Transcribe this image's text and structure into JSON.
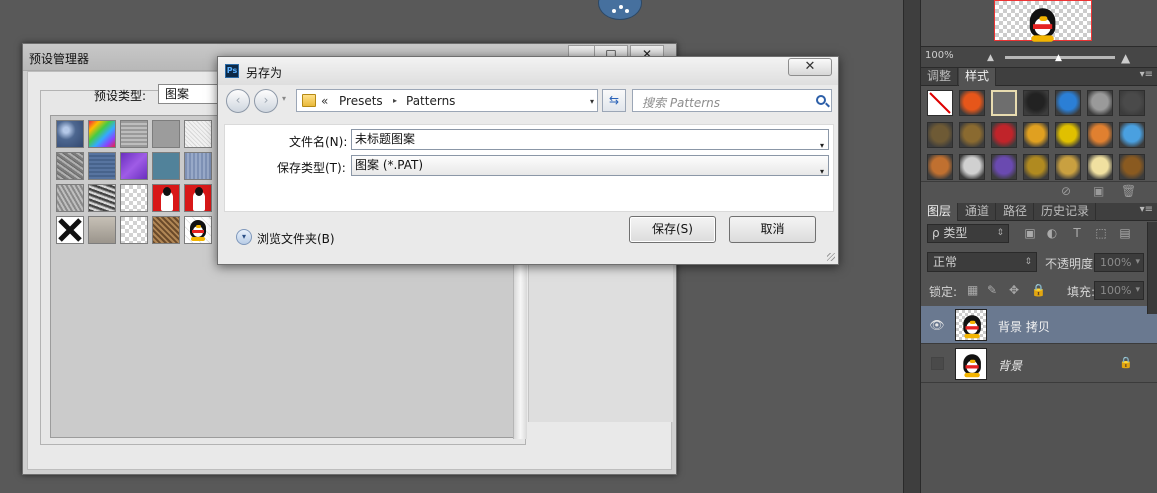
{
  "preset_manager": {
    "title": "预设管理器",
    "controls": {
      "minimize": "_",
      "maximize": "□",
      "close": "✕"
    },
    "preset_type_label": "预设类型:",
    "preset_type_value": "图案",
    "swatches": [
      "bubbles-pattern",
      "rainbow-pattern",
      "gray-granite-pattern",
      "gray-pattern",
      "light-gray-pattern",
      "stone-pattern",
      "blue-stone-pattern",
      "purple-pattern",
      "teal-pattern",
      "blue-gray-pattern",
      "gray-texture-pattern",
      "black-white-noise-pattern",
      "transparent-checker-pattern",
      "portrait-red-1-pattern",
      "portrait-red-2-pattern",
      "x-mark-pattern",
      "concrete-pattern",
      "wood-pattern",
      "white-dots-pattern",
      "penguin-pattern"
    ]
  },
  "save_dialog": {
    "title": "另存为",
    "ps_badge": "Ps",
    "close_glyph": "✕",
    "nav_back": "‹",
    "nav_forward": "›",
    "nav_dropdown": "▾",
    "address_prefix": "«",
    "breadcrumbs": [
      "Presets",
      "Patterns"
    ],
    "crumb_separator": "▸",
    "address_dropdown": "▾",
    "refresh_glyph": "⇆",
    "search_placeholder": "搜索 Patterns",
    "filename_label": "文件名(N):",
    "filename_value": "未标题图案",
    "filetype_label": "保存类型(T):",
    "filetype_value": "图案 (*.PAT)",
    "dropdown_glyph": "▾",
    "browse_glyph": "▾",
    "browse_label": "浏览文件夹(B)",
    "save_button": "保存(S)",
    "cancel_button": "取消"
  },
  "right_panels": {
    "zoom": "100%",
    "zoom_min_glyph": "▲",
    "zoom_handle_glyph": "▲",
    "zoom_max_glyph": "▲",
    "menu_glyph": "▾≡",
    "style_tabs": [
      "调整",
      "样式"
    ],
    "style_swatches": [
      {
        "name": "none-style",
        "color": "#ffffff"
      },
      {
        "name": "red-glow-style",
        "color": "#e6561a"
      },
      {
        "name": "beige-frame-style",
        "color": "#6e6e6e"
      },
      {
        "name": "black-chrome-style",
        "color": "#222222"
      },
      {
        "name": "blue-glass-style",
        "color": "#2b7fd6"
      },
      {
        "name": "gray-flat-style",
        "color": "#9a9a9a"
      },
      {
        "name": "dark-gray-style",
        "color": "#4a4a4a"
      },
      {
        "name": "bronze-style",
        "color": "#6e5a35"
      },
      {
        "name": "brown-bevel-style",
        "color": "#8a6a30"
      },
      {
        "name": "red-stripe-style",
        "color": "#c0242a"
      },
      {
        "name": "multicolor-style",
        "color": "#e0a020"
      },
      {
        "name": "yellow-frame-style",
        "color": "#e0c000"
      },
      {
        "name": "orange-gradient-style",
        "color": "#e08030"
      },
      {
        "name": "light-blue-style",
        "color": "#4aa0e0"
      },
      {
        "name": "sunset-style",
        "color": "#c07030"
      },
      {
        "name": "crystal-style",
        "color": "#d0d0d0"
      },
      {
        "name": "purple-bevel-style",
        "color": "#6a4ab0"
      },
      {
        "name": "gold-ornament-style",
        "color": "#b08a20"
      },
      {
        "name": "gold-frame-style",
        "color": "#c9a040"
      },
      {
        "name": "cream-frame-style",
        "color": "#f0e0a0"
      },
      {
        "name": "bronze-frame-style",
        "color": "#8a5a20"
      }
    ],
    "style_footer_glyphs": [
      "⊘",
      "▣",
      "🗑"
    ],
    "layer_tabs": [
      "图层",
      "通道",
      "路径",
      "历史记录"
    ],
    "filter_kind": "ρ 类型",
    "filter_dropdown": "⇕",
    "filter_icons": [
      "▣",
      "◐",
      "T",
      "⬚",
      "▤"
    ],
    "blend_mode": "正常",
    "blend_dropdown": "⇕",
    "opacity_label": "不透明度:",
    "opacity_value": "100%",
    "lock_label": "锁定:",
    "lock_icons": [
      "▦",
      "✎",
      "✥",
      "🔒"
    ],
    "fill_label": "填充:",
    "fill_value": "100%",
    "value_dropdown": "▾",
    "layers": [
      {
        "name": "背景 拷贝",
        "visible_glyph": "👁"
      },
      {
        "name": "背景",
        "visible_glyph": "",
        "lock_glyph": "🔒"
      }
    ]
  }
}
